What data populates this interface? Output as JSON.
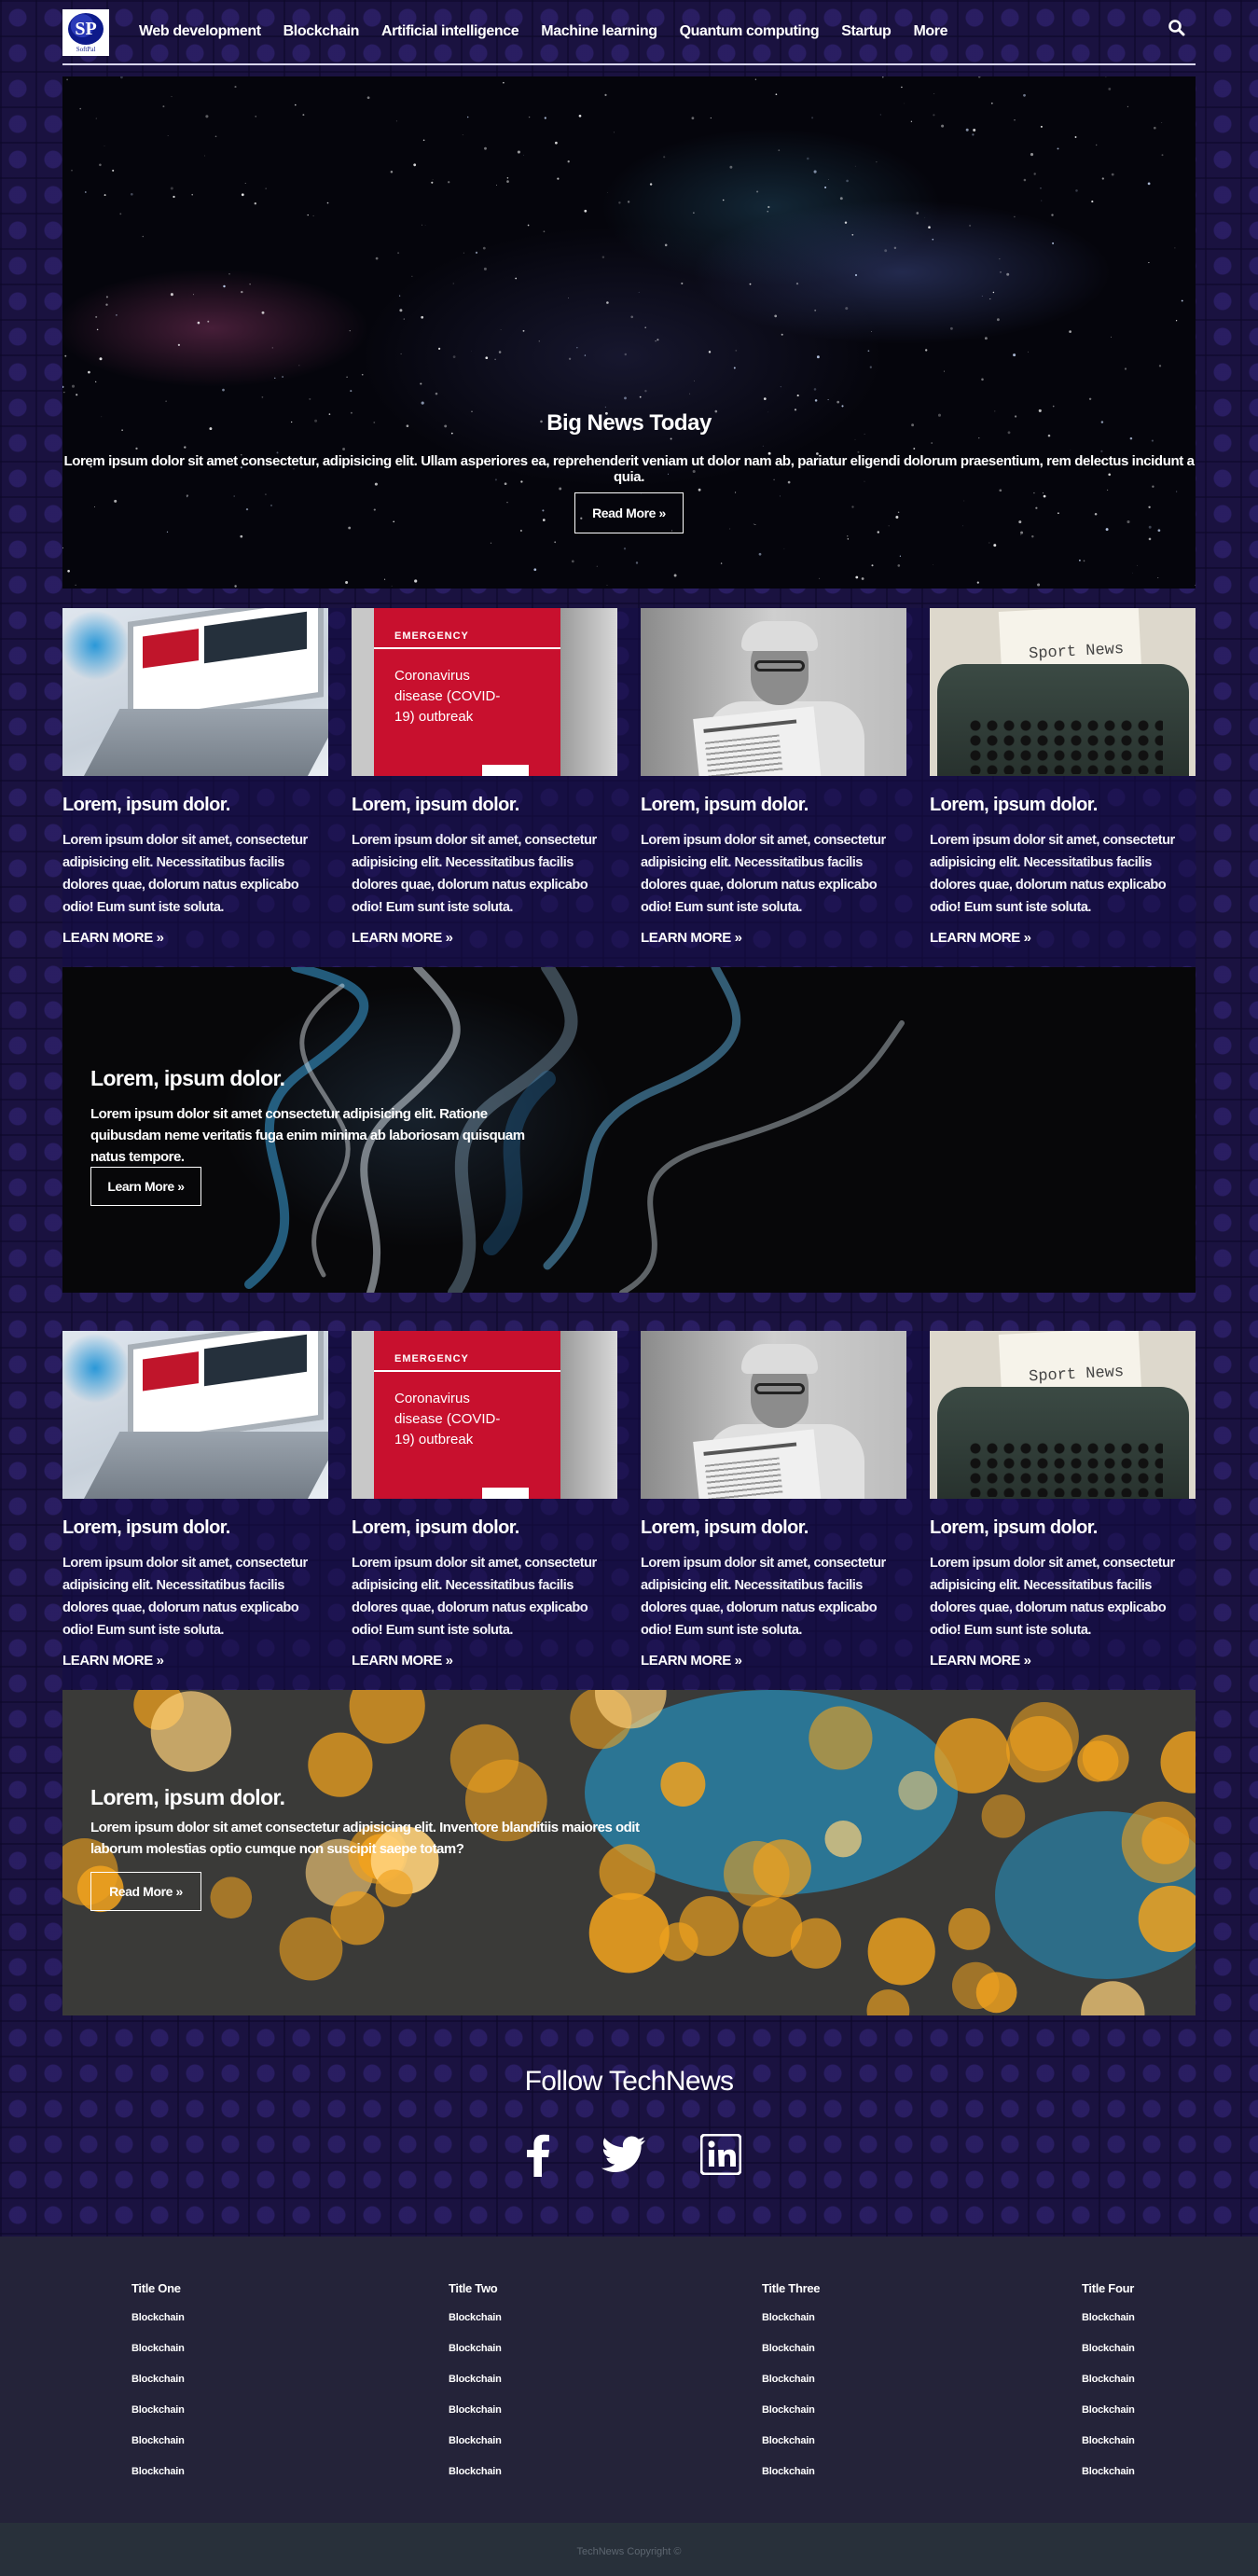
{
  "logo": {
    "mark": "SP",
    "text": "SoftPal"
  },
  "nav": {
    "links": [
      "Web development",
      "Blockchain",
      "Artificial intelligence",
      "Machine learning",
      "Quantum computing",
      "Startup",
      "More"
    ]
  },
  "hero": {
    "title": "Big News Today",
    "text": "Lorem ipsum dolor sit amet consectetur, adipisicing elit. Ullam asperiores ea, reprehenderit veniam ut dolor nam ab, pariatur eligendi dolorum praesentium, rem delectus incidunt a quia.",
    "button": "Read More »"
  },
  "images": {
    "covid_label": "EMERGENCY",
    "covid_lines": [
      "Coronavirus",
      "disease (COVID-",
      "19) outbreak"
    ],
    "typewriter_text": "Sport News"
  },
  "cards_row_1": [
    {
      "title": "Lorem, ipsum dolor.",
      "text": "Lorem ipsum dolor sit amet, consectetur adipisicing elit. Necessitatibus facilis dolores quae, dolorum natus explicabo odio! Eum sunt iste soluta.",
      "link": "LEARN MORE »"
    },
    {
      "title": "Lorem, ipsum dolor.",
      "text": "Lorem ipsum dolor sit amet, consectetur adipisicing elit. Necessitatibus facilis dolores quae, dolorum natus explicabo odio! Eum sunt iste soluta.",
      "link": "LEARN MORE »"
    },
    {
      "title": "Lorem, ipsum dolor.",
      "text": "Lorem ipsum dolor sit amet, consectetur adipisicing elit. Necessitatibus facilis dolores quae, dolorum natus explicabo odio! Eum sunt iste soluta.",
      "link": "LEARN MORE »"
    },
    {
      "title": "Lorem, ipsum dolor.",
      "text": "Lorem ipsum dolor sit amet, consectetur adipisicing elit. Necessitatibus facilis dolores quae, dolorum natus explicabo odio! Eum sunt iste soluta.",
      "link": "LEARN MORE »"
    }
  ],
  "banner_1": {
    "title": "Lorem, ipsum dolor.",
    "text": "Lorem ipsum dolor sit amet consectetur adipisicing elit. Ratione quibusdam neme veritatis fuga enim minima ab laboriosam quisquam natus tempore.",
    "button": "Learn More »"
  },
  "cards_row_2": [
    {
      "title": "Lorem, ipsum dolor.",
      "text": "Lorem ipsum dolor sit amet, consectetur adipisicing elit. Necessitatibus facilis dolores quae, dolorum natus explicabo odio! Eum sunt iste soluta.",
      "link": "LEARN MORE »"
    },
    {
      "title": "Lorem, ipsum dolor.",
      "text": "Lorem ipsum dolor sit amet, consectetur adipisicing elit. Necessitatibus facilis dolores quae, dolorum natus explicabo odio! Eum sunt iste soluta.",
      "link": "LEARN MORE »"
    },
    {
      "title": "Lorem, ipsum dolor.",
      "text": "Lorem ipsum dolor sit amet, consectetur adipisicing elit. Necessitatibus facilis dolores quae, dolorum natus explicabo odio! Eum sunt iste soluta.",
      "link": "LEARN MORE »"
    },
    {
      "title": "Lorem, ipsum dolor.",
      "text": "Lorem ipsum dolor sit amet, consectetur adipisicing elit. Necessitatibus facilis dolores quae, dolorum natus explicabo odio! Eum sunt iste soluta.",
      "link": "LEARN MORE »"
    }
  ],
  "banner_2": {
    "title": "Lorem, ipsum dolor.",
    "text": "Lorem ipsum dolor sit amet consectetur adipisicing elit. Inventore blanditiis maiores odit laborum molestias optio cumque non suscipit saepe totam?",
    "button": "Read More »"
  },
  "follow": {
    "title": "Follow TechNews",
    "icons": [
      "facebook-icon",
      "twitter-icon",
      "linkedin-icon"
    ]
  },
  "footer": {
    "columns": [
      {
        "title": "Title One",
        "items": [
          "Blockchain",
          "Blockchain",
          "Blockchain",
          "Blockchain",
          "Blockchain",
          "Blockchain"
        ]
      },
      {
        "title": "Title Two",
        "items": [
          "Blockchain",
          "Blockchain",
          "Blockchain",
          "Blockchain",
          "Blockchain",
          "Blockchain"
        ]
      },
      {
        "title": "Title Three",
        "items": [
          "Blockchain",
          "Blockchain",
          "Blockchain",
          "Blockchain",
          "Blockchain",
          "Blockchain"
        ]
      },
      {
        "title": "Title Four",
        "items": [
          "Blockchain",
          "Blockchain",
          "Blockchain",
          "Blockchain",
          "Blockchain",
          "Blockchain"
        ]
      }
    ],
    "copyright": "TechNews Copyright ©"
  },
  "colors": {
    "background": "#1a1240",
    "footer": "#242339",
    "copyright_bar": "#28303a",
    "accent_red": "#c8102e"
  }
}
